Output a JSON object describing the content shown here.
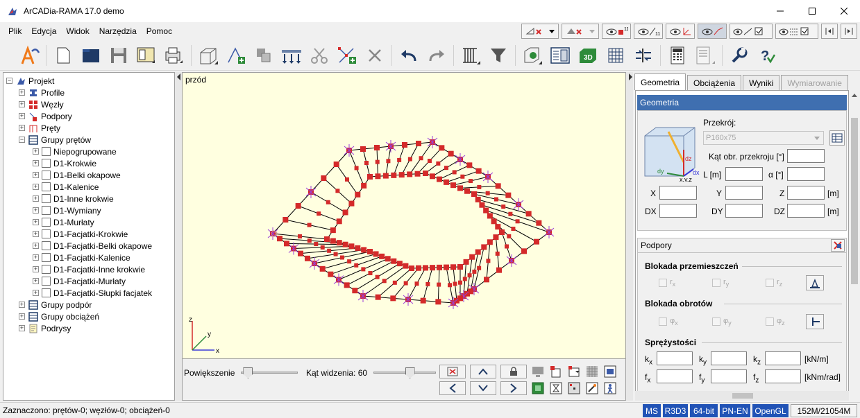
{
  "window": {
    "title": "ArCADia-RAMA 17.0 demo"
  },
  "menu": [
    "Plik",
    "Edycja",
    "Widok",
    "Narzędzia",
    "Pomoc"
  ],
  "menu_buttons": {
    "visible_counter_1": "11",
    "visible_counter_2": "11"
  },
  "tree": {
    "root": "Projekt",
    "items": [
      {
        "label": "Profile",
        "icon": "profile-icon"
      },
      {
        "label": "Węzły",
        "icon": "nodes-icon"
      },
      {
        "label": "Podpory",
        "icon": "supports-icon"
      },
      {
        "label": "Pręty",
        "icon": "bars-icon"
      },
      {
        "label": "Grupy prętów",
        "icon": "bar-groups-icon"
      }
    ],
    "groups": [
      "Niepogrupowane",
      "D1-Krokwie",
      "D1-Belki okapowe",
      "D1-Kalenice",
      "D1-Inne krokwie",
      "D1-Wymiany",
      "D1-Murłaty",
      "D1-Facjatki-Krokwie",
      "D1-Facjatki-Belki okapowe",
      "D1-Facjatki-Kalenice",
      "D1-Facjatki-Inne krokwie",
      "D1-Facjatki-Murłaty",
      "D1-Facjatki-Słupki facjatek"
    ],
    "bottom_items": [
      {
        "label": "Grupy podpór",
        "icon": "support-groups-icon"
      },
      {
        "label": "Grupy obciążeń",
        "icon": "load-groups-icon"
      },
      {
        "label": "Podrysy",
        "icon": "underlays-icon"
      }
    ]
  },
  "viewport": {
    "view_name": "przód",
    "zoom_label": "Powiększenie",
    "zoom_level": 0.05,
    "fov_label": "Kąt widzenia: 60",
    "fov_level": 0.6,
    "axes": {
      "x": "x",
      "y": "y",
      "z": "z"
    }
  },
  "right_panel": {
    "tabs": [
      {
        "label": "Geometria",
        "state": "active"
      },
      {
        "label": "Obciążenia",
        "state": "normal"
      },
      {
        "label": "Wyniki",
        "state": "normal"
      },
      {
        "label": "Wymiarowanie",
        "state": "disabled"
      }
    ],
    "geometria": {
      "header": "Geometria",
      "cross_section_label": "Przekrój:",
      "cross_section_value": "P160x75",
      "angle_label": "Kąt obr. przekroju [°]",
      "L_label": "L [m]",
      "alpha_label": "α [°]",
      "X_label": "X",
      "Y_label": "Y",
      "Z_label": "Z",
      "unit_m": "[m]",
      "DX_label": "DX",
      "DY_label": "DY",
      "DZ_label": "DZ",
      "unit_m2": "[m]",
      "cube_labels": {
        "dz": "dz",
        "dy": "dy",
        "dx": "dx",
        "xyz": "x,y,z"
      }
    },
    "podpory": {
      "header": "Podpory",
      "block_disp_title": "Blokada przemieszczeń",
      "disp": {
        "rx": "r",
        "ry": "r",
        "rz": "r",
        "sx": "x",
        "sy": "y",
        "sz": "z"
      },
      "block_rot_title": "Blokada obrotów",
      "rot": {
        "px": "φ",
        "py": "φ",
        "pz": "φ",
        "sx": "x",
        "sy": "y",
        "sz": "z"
      },
      "spr_title": "Sprężystości",
      "k": {
        "kx": "k",
        "ky": "k",
        "kz": "k",
        "sx": "x",
        "sy": "y",
        "sz": "z",
        "unit": "[kN/m]"
      },
      "f": {
        "fx": "f",
        "fy": "f",
        "fz": "f",
        "sx": "x",
        "sy": "y",
        "sz": "z",
        "unit": "[kNm/rad]"
      }
    }
  },
  "status": {
    "text": "Zaznaczono: prętów-0; węzłów-0; obciążeń-0",
    "badges": [
      "MS",
      "R3D3",
      "64-bit",
      "PN-EN",
      "OpenGL"
    ],
    "memory": "152M/21054M"
  },
  "colors": {
    "accent": "#2153b6",
    "node": "#d42a2a",
    "support": "#9b3fd8",
    "viewport_bg": "#ffffe0"
  }
}
